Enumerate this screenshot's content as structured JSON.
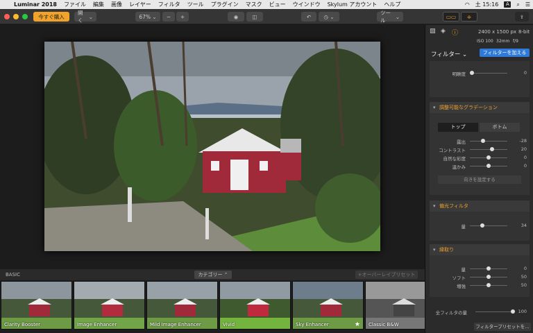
{
  "menubar": {
    "app_name": "Luminar 2018",
    "items": [
      "ファイル",
      "編集",
      "画像",
      "レイヤー",
      "フィルタ",
      "ツール",
      "プラグイン",
      "マスク",
      "ビュー",
      "ウインドウ",
      "Skylum アカウント",
      "ヘルプ"
    ],
    "clock": "土 15:16",
    "input_badge": "A"
  },
  "toolbar": {
    "buy_label": "今すぐ購入",
    "open_label": "開く",
    "zoom": "67%",
    "zoom_out": "−",
    "zoom_in": "+",
    "tools_label": "ツール"
  },
  "filmstrip": {
    "category_label": "BASIC",
    "category_button": "カテゴリー",
    "overlay_button": "オーバーレイプリセット",
    "presets": [
      "Clarity Booster",
      "Image Enhancer",
      "Mild Image Enhancer",
      "Vivid",
      "Sky Enhancer",
      "Classic B&W"
    ]
  },
  "panel": {
    "dimensions": "2400 x 1500 px",
    "bit_depth": "8-bit",
    "iso": "ISO 100",
    "focal": "32mm",
    "aperture": "f/9",
    "filters_title": "フィルター",
    "add_filter_button": "フィルターを加える",
    "brightness_label": "明瞭度",
    "brightness_value": "0",
    "gradient": {
      "title": "調整可能なグラデーション",
      "tab_top": "トップ",
      "tab_bottom": "ボトム",
      "rows": [
        {
          "label": "露出",
          "value": "-28",
          "pos": 0.35
        },
        {
          "label": "コントラスト",
          "value": "20",
          "pos": 0.6
        },
        {
          "label": "自然な彩度",
          "value": "0",
          "pos": 0.5
        },
        {
          "label": "温かみ",
          "value": "0",
          "pos": 0.5
        }
      ],
      "orient_button": "向きを設定する"
    },
    "polarizing": {
      "title": "偏光フィルタ",
      "amount_label": "量",
      "amount_value": "34",
      "pos": 0.34
    },
    "vignette": {
      "title": "縁取り",
      "rows": [
        {
          "label": "量",
          "value": "0",
          "pos": 0.5
        },
        {
          "label": "ソフト",
          "value": "50",
          "pos": 0.5
        },
        {
          "label": "増強",
          "value": "50",
          "pos": 0.5
        }
      ]
    },
    "global_amount_label": "全フィルタの量",
    "global_amount_value": "100",
    "save_preset_button": "フィルタープリセットを…"
  },
  "colors": {
    "accent": "#f0a22a",
    "blue": "#2f7ad8"
  }
}
